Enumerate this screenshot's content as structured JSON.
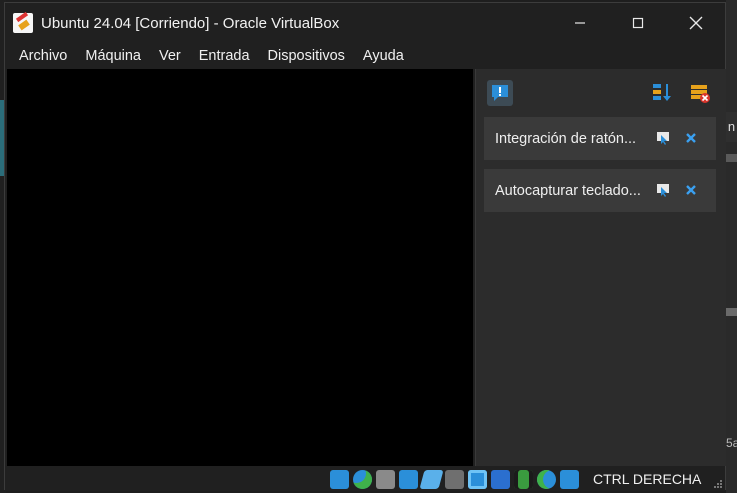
{
  "window": {
    "title": "Ubuntu 24.04 [Corriendo] - Oracle VirtualBox"
  },
  "menu": {
    "items": [
      "Archivo",
      "Máquina",
      "Ver",
      "Entrada",
      "Dispositivos",
      "Ayuda"
    ]
  },
  "notifications": {
    "items": [
      {
        "text": "Integración de ratón..."
      },
      {
        "text": "Autocapturar teclado..."
      }
    ]
  },
  "statusbar": {
    "host_key": "CTRL DERECHA",
    "icons": [
      "hard-disk-icon",
      "optical-drive-icon",
      "audio-icon",
      "network-icon",
      "usb-icon",
      "shared-folders-icon",
      "display-icon",
      "recording-icon",
      "cpu-icon",
      "mouse-integration-icon",
      "keyboard-icon"
    ]
  },
  "background": {
    "right_tab_text": "n",
    "right_small_text": "5a"
  },
  "colors": {
    "window_bg": "#202020",
    "panel_bg": "#2c2c2c",
    "notification_bg": "#3a3a3a",
    "accent_blue": "#2b8fd9"
  }
}
